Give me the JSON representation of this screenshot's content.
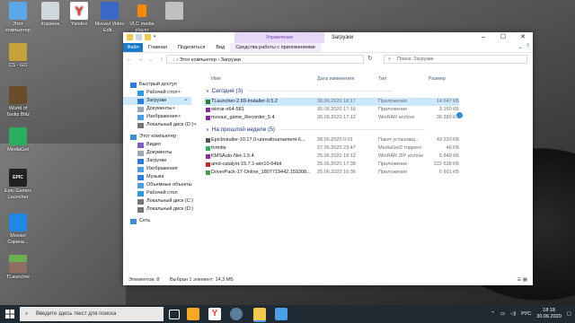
{
  "desktop": {
    "icons": [
      {
        "label": "Этот компьютер",
        "color": "#5aa9e6"
      },
      {
        "label": "Корзина",
        "color": "#cfd8dc"
      },
      {
        "label": "Yandex",
        "color": "#ff3b30"
      },
      {
        "label": "Movavi Video Edit...",
        "color": "#3b67c8"
      },
      {
        "label": "VLC media player",
        "color": "#ff8800"
      },
      {
        "label": "",
        "color": "#c0c0c0"
      },
      {
        "label": "CS - GO",
        "color": "#c5a33a"
      },
      {
        "label": "World of Tanks Blitz",
        "color": "#6b4c2a"
      },
      {
        "label": "MediaGet",
        "color": "#27ae60"
      },
      {
        "label": "Epic Games Launcher",
        "color": "#222222"
      },
      {
        "label": "Movavi Скрина...",
        "color": "#1e88e5"
      },
      {
        "label": "TLauncher",
        "color": "#4caf50"
      }
    ]
  },
  "window": {
    "title": "Загрузки",
    "context_tab": "Управление",
    "ribbon_tabs": [
      "Файл",
      "Главная",
      "Поделиться",
      "Вид",
      "Средства работы с приложениями"
    ],
    "path": [
      "Этот компьютер",
      "Загрузки"
    ],
    "search_placeholder": "Поиск: Загрузки",
    "columns": {
      "name": "Имя",
      "date": "Дата изменения",
      "type": "Тип",
      "size": "Размер"
    },
    "nav": [
      {
        "label": "Быстрый доступ",
        "icon": "star-icon",
        "color": "#2b7de1"
      },
      {
        "label": "Рабочий стол",
        "icon": "desktop-icon",
        "color": "#2b9be1"
      },
      {
        "label": "Загрузки",
        "icon": "download-icon",
        "color": "#2b7de1"
      },
      {
        "label": "Документы",
        "icon": "documents-icon",
        "color": "#9aa7b5"
      },
      {
        "label": "Изображения",
        "icon": "pictures-icon",
        "color": "#4aa0e6"
      },
      {
        "label": "Локальный диск (D:)",
        "icon": "drive-icon",
        "color": "#777777"
      },
      {
        "label": "Этот компьютер",
        "icon": "computer-icon",
        "color": "#3a8fd8"
      },
      {
        "label": "Видео",
        "icon": "video-icon",
        "color": "#7a5dc7"
      },
      {
        "label": "Документы",
        "icon": "documents-icon",
        "color": "#9aa7b5"
      },
      {
        "label": "Загрузки",
        "icon": "download-icon",
        "color": "#2b7de1"
      },
      {
        "label": "Изображения",
        "icon": "pictures-icon",
        "color": "#4aa0e6"
      },
      {
        "label": "Музыка",
        "icon": "music-icon",
        "color": "#2b7de1"
      },
      {
        "label": "Объемные объекты",
        "icon": "3d-objects-icon",
        "color": "#4aa0e6"
      },
      {
        "label": "Рабочий стол",
        "icon": "desktop-icon",
        "color": "#2b9be1"
      },
      {
        "label": "Локальный диск (C:)",
        "icon": "drive-icon",
        "color": "#777777"
      },
      {
        "label": "Локальный диск (D:)",
        "icon": "drive-icon",
        "color": "#777777"
      },
      {
        "label": "Сеть",
        "icon": "network-icon",
        "color": "#3a8fd8"
      }
    ],
    "groups": [
      {
        "label": "Сегодня (3)",
        "files": [
          {
            "name": "TLauncher-2.69-Installer-0.5.2",
            "date": "30.06.2020 18:17",
            "type": "Приложение",
            "size": "14 647 КБ",
            "color": "#2e7d32",
            "selected": true
          },
          {
            "name": "winrar-x64-581",
            "date": "30.06.2020 17:16",
            "type": "Приложение",
            "size": "3 160 КБ",
            "color": "#8e24aa",
            "selected": false
          },
          {
            "name": "movavi_game_Recorder_5.4",
            "date": "30.06.2020 17:12",
            "type": "WinRAR archive",
            "size": "30 280 КБ",
            "color": "#8e24aa",
            "selected": false
          }
        ]
      },
      {
        "label": "На прошлой неделе (5)",
        "files": [
          {
            "name": "EpicInstaller-10.17.0-unrealtournament-6...",
            "date": "28.06.2020 0:01",
            "type": "Пакет установщ...",
            "size": "43 220 КБ",
            "color": "#555555",
            "selected": false
          },
          {
            "name": "fortnite",
            "date": "27.06.2020 23:47",
            "type": "MediaGet2 торрент",
            "size": "46 КБ",
            "color": "#27ae60",
            "selected": false
          },
          {
            "name": "KMSAuto-Net-1.5.4",
            "date": "25.06.2020 18:12",
            "type": "WinRAR ZIP archive",
            "size": "5 649 КБ",
            "color": "#8e24aa",
            "selected": false
          },
          {
            "name": "amd-catalyst-15.7.1-win10-64bit",
            "date": "25.06.2020 17:38",
            "type": "Приложение",
            "size": "222 638 КБ",
            "color": "#c62828",
            "selected": false
          },
          {
            "name": "DriverPack-17-Online_1807719442.159308...",
            "date": "25.06.2020 16:36",
            "type": "Приложение",
            "size": "6 601 КБ",
            "color": "#43a047",
            "selected": false
          }
        ]
      }
    ],
    "status": {
      "count": "Элементов: 8",
      "selection": "Выбран 1 элемент: 14,3 МБ"
    }
  },
  "taskbar": {
    "search_placeholder": "Введите здесь текст для поиска",
    "language": "РУС",
    "time": "18:18",
    "date": "30.06.2020",
    "apps": [
      {
        "name": "task-view-icon",
        "color": "#ffffff"
      },
      {
        "name": "movavi-icon",
        "color": "#f9a825"
      },
      {
        "name": "yandex-browser-icon",
        "color": "#ff3b30"
      },
      {
        "name": "steam-icon",
        "color": "#5c7e9e"
      },
      {
        "name": "explorer-icon",
        "color": "#f2c94c"
      },
      {
        "name": "mail-icon",
        "color": "#4aa0e6"
      }
    ]
  }
}
